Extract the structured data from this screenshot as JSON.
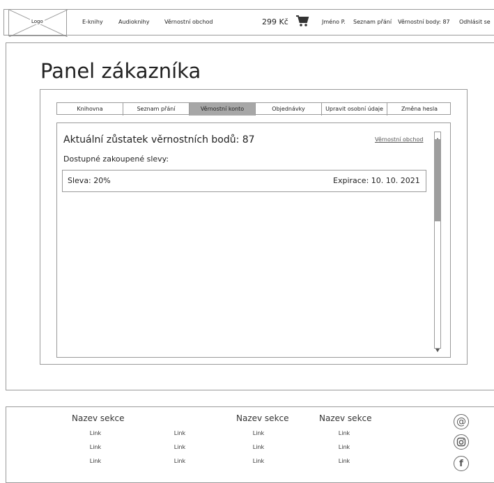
{
  "header": {
    "logo": "Logo",
    "nav": [
      "E-knihy",
      "Audioknihy",
      "Věrnostní obchod"
    ],
    "cart_price": "299 Kč",
    "user_name": "Jméno P.",
    "wishlist": "Seznam přání",
    "loyalty_points": "Věrnostní body: 87",
    "logout": "Odhlásit se"
  },
  "main": {
    "title": "Panel zákazníka",
    "tabs": [
      {
        "label": "Knihovna",
        "active": false
      },
      {
        "label": "Seznam přání",
        "active": false
      },
      {
        "label": "Věrnostní konto",
        "active": true
      },
      {
        "label": "Objednávky",
        "active": false
      },
      {
        "label": "Upravit osobní údaje",
        "active": false
      },
      {
        "label": "Změna hesla",
        "active": false
      }
    ],
    "balance": "Aktuální zůstatek věrnostních bodů: 87",
    "shop_link": "Věrnostní obchod",
    "discounts_heading": "Dostupné zakoupené slevy:",
    "discounts": [
      {
        "label": "Sleva: 20%",
        "expiry": "Expirace: 10. 10. 2021"
      }
    ]
  },
  "footer": {
    "columns": [
      {
        "heading": "Nazev sekce",
        "links": [
          "Link",
          "Link",
          "Link"
        ]
      },
      {
        "heading": "",
        "links": [
          "Link",
          "Link",
          "Link"
        ]
      },
      {
        "heading": "Nazev sekce",
        "links": [
          "Link",
          "Link",
          "Link"
        ]
      },
      {
        "heading": "Nazev sekce",
        "links": [
          "Link",
          "Link",
          "Link"
        ]
      }
    ],
    "social_icons": [
      "at-sign-icon",
      "instagram-icon",
      "facebook-icon"
    ]
  }
}
